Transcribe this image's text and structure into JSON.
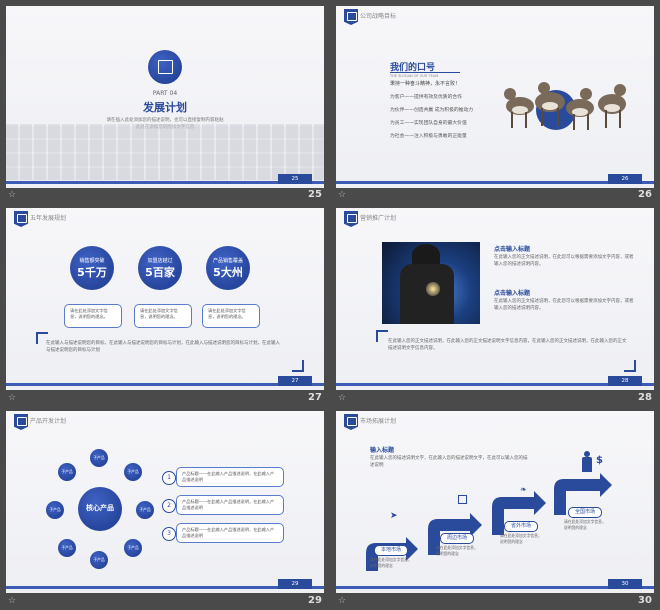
{
  "slides": [
    {
      "page": "25",
      "part": "PART 04",
      "title": "发展计划",
      "sub1": "请在插入此处添加您的描述说明，也可以直接复制内容粘贴",
      "sub2": "此处在添加您的附加文字信息"
    },
    {
      "page": "26",
      "header": "公司战略目标",
      "slogan_title": "我们的口号",
      "slogan_en": "THE SLOGAN OF OUR TEAM",
      "slogan_line": "秉持一种奋斗精神，永不言败！",
      "items": [
        "为客户——提供有效及优质的合作",
        "为伙伴——创造共赢 成为积极的推动力",
        "为员工——实现团队自身的最大价值",
        "为社会——注入积极与勇敢的正能量"
      ]
    },
    {
      "page": "27",
      "header": "五年发展规划",
      "circles": [
        {
          "top": "销售额突破",
          "big": "5千万"
        },
        {
          "top": "加盟店越过",
          "big": "5百家"
        },
        {
          "top": "产品销售覆盖",
          "big": "5大州"
        }
      ],
      "box_text": "请在此处添加文字信息，说明您的理念。",
      "para": "在此输入与描述说明您的目标，在此输入与描述说明您的目标与计划，在此输入与描述说明您的目标与计划，在此输入与描述说明您的目标与计划"
    },
    {
      "page": "28",
      "header": "营销推广计划",
      "h1": "点击输入标题",
      "p1": "在此输入您的正文描述说明，在此您可以根据需要添加文字内容，或者输入您的描述说明内容。",
      "h2": "点击输入标题",
      "p2": "在此输入您的正文描述说明，在此您可以根据需要添加文字内容，或者输入您的描述说明内容。",
      "para": "在此输入您的正文描述说明，在此输入您的正文描述说明文字信息内容，在此输入您的正文描述说明，在此输入您的正文描述说明文字信息内容。"
    },
    {
      "page": "29",
      "header": "产品开发计划",
      "center": "核心产品",
      "node": "子产品",
      "bars": [
        {
          "n": "1",
          "t": "产品标题——在此输入产品描述说明，在此输入产品描述说明"
        },
        {
          "n": "2",
          "t": "产品标题——在此输入产品描述说明，在此输入产品描述说明"
        },
        {
          "n": "3",
          "t": "产品标题——在此输入产品描述说明，在此输入产品描述说明"
        }
      ]
    },
    {
      "page": "30",
      "header": "市场拓展计划",
      "intro_title": "输入标题",
      "intro": "在此输入您的描述说明文字，在此输入您的描述说明文字，在此可以输入您的描述说明",
      "markets": [
        "本地市场",
        "周边市场",
        "省外市场",
        "全国市场"
      ],
      "mtext": "请在此处添加文字信息，说明您的理念"
    }
  ],
  "thumbs": [
    {
      "n": "25"
    },
    {
      "n": "26"
    },
    {
      "n": "27"
    },
    {
      "n": "28"
    },
    {
      "n": "29"
    },
    {
      "n": "30"
    }
  ]
}
